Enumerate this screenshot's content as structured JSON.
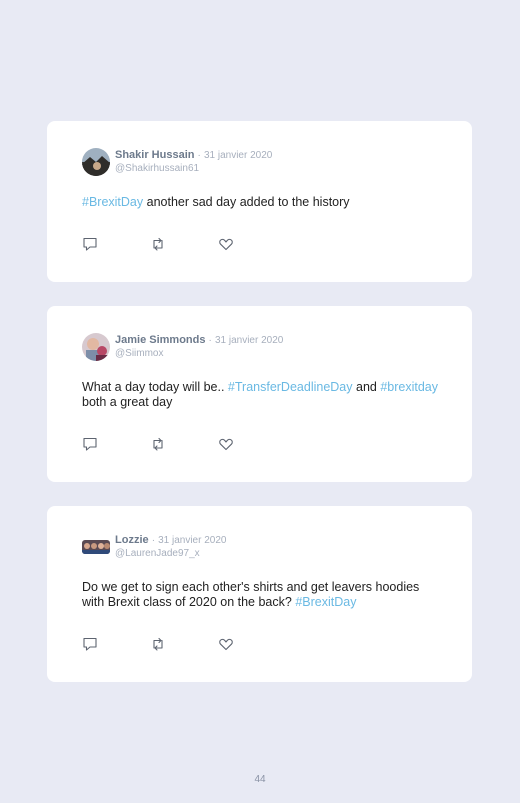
{
  "tweets": [
    {
      "name": "Shakir Hussain",
      "separator": "·",
      "date": "31 janvier 2020",
      "handle": "@Shakirhussain61",
      "tag1": "#BrexitDay",
      "text1": " another sad day added to the history",
      "tag2": "",
      "text2": "",
      "icons": [
        "reply-icon",
        "retweet-icon",
        "like-icon"
      ]
    },
    {
      "name": "Jamie Simmonds",
      "separator": "·",
      "date": "31 janvier 2020",
      "handle": "@Siimmox",
      "text0": "What a day today will be.. ",
      "tag1": "#TransferDeadlineDay",
      "text1": " and ",
      "tag2": "#brexitday",
      "text2": " both a great day",
      "icons": [
        "reply-icon",
        "retweet-icon",
        "like-icon"
      ]
    },
    {
      "name": "Lozzie",
      "separator": "·",
      "date": "31 janvier 2020",
      "handle": "@LaurenJade97_x",
      "text0": "Do we get to sign each other's shirts and get leavers hoodies with Brexit class of 2020 on the back? ",
      "tag1": "#BrexitDay",
      "icons": [
        "reply-icon",
        "retweet-icon",
        "like-icon"
      ]
    }
  ],
  "page_number": "44",
  "colors": {
    "background": "#e8eaf4",
    "card": "#ffffff",
    "hashtag": "#6ab9e3",
    "name": "#6d7a8c",
    "muted": "#a7afbd"
  }
}
